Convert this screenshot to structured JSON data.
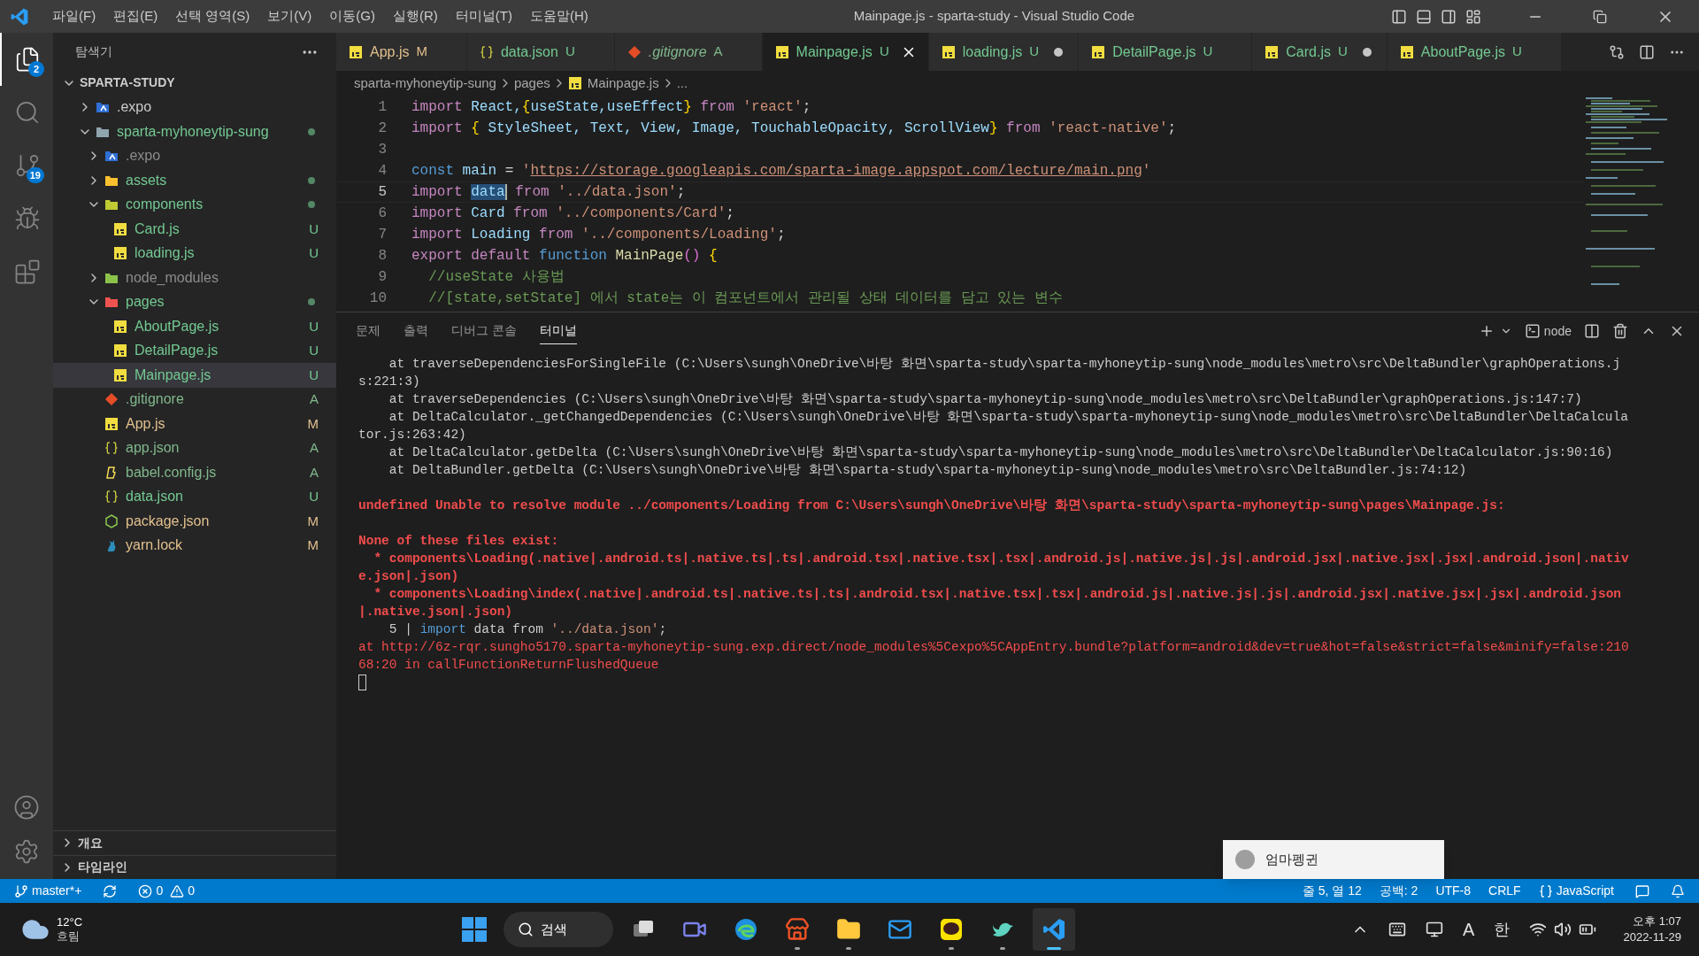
{
  "window": {
    "title": "Mainpage.js - sparta-study - Visual Studio Code"
  },
  "menu": [
    "파일(F)",
    "편집(E)",
    "선택 영역(S)",
    "보기(V)",
    "이동(G)",
    "실행(R)",
    "터미널(T)",
    "도움말(H)"
  ],
  "activity_bar": [
    {
      "kind": "explorer",
      "selected": true,
      "badge": "2"
    },
    {
      "kind": "search",
      "selected": false
    },
    {
      "kind": "source-control",
      "selected": false,
      "badge": "19"
    },
    {
      "kind": "debug",
      "selected": false
    },
    {
      "kind": "extensions",
      "selected": false
    }
  ],
  "sidebar": {
    "title": "탐색기",
    "root": {
      "label": "SPARTA-STUDY",
      "expanded": true
    },
    "tree": [
      {
        "name": ".expo",
        "kind": "folder-expo",
        "color": "#cccccc",
        "expanded": false,
        "dot": false,
        "selected": false
      },
      {
        "name": "sparta-myhoneytip-sung",
        "kind": "folder",
        "color": "#73c991",
        "expanded": true,
        "dot": true,
        "selected": false,
        "children": [
          {
            "name": ".expo",
            "kind": "folder-expo",
            "color": "#8c8c8c",
            "expanded": false,
            "dot": false,
            "selected": false
          },
          {
            "name": "assets",
            "kind": "folder-assets",
            "color": "#73c991",
            "expanded": false,
            "dot": true,
            "selected": false
          },
          {
            "name": "components",
            "kind": "folder-components",
            "color": "#73c991",
            "expanded": true,
            "dot": true,
            "selected": false,
            "children": [
              {
                "name": "Card.js",
                "kind": "js",
                "color": "#73c991",
                "badge": "U",
                "selected": false
              },
              {
                "name": "loading.js",
                "kind": "js",
                "color": "#73c991",
                "badge": "U",
                "selected": false
              }
            ]
          },
          {
            "name": "node_modules",
            "kind": "folder-node",
            "color": "#8c8c8c",
            "expanded": false,
            "dot": false,
            "selected": false
          },
          {
            "name": "pages",
            "kind": "folder-pages",
            "color": "#73c991",
            "expanded": true,
            "dot": true,
            "selected": false,
            "children": [
              {
                "name": "AboutPage.js",
                "kind": "js",
                "color": "#73c991",
                "badge": "U",
                "selected": false
              },
              {
                "name": "DetailPage.js",
                "kind": "js",
                "color": "#73c991",
                "badge": "U",
                "selected": false
              },
              {
                "name": "Mainpage.js",
                "kind": "js",
                "color": "#73c991",
                "badge": "U",
                "selected": true
              }
            ]
          },
          {
            "name": ".gitignore",
            "kind": "git",
            "color": "#81b88b",
            "badge": "A",
            "selected": false
          },
          {
            "name": "App.js",
            "kind": "js",
            "color": "#e2c08d",
            "badge": "M",
            "selected": false
          },
          {
            "name": "app.json",
            "kind": "json",
            "color": "#81b88b",
            "badge": "A",
            "selected": false
          },
          {
            "name": "babel.config.js",
            "kind": "babel",
            "color": "#81b88b",
            "badge": "A",
            "selected": false
          },
          {
            "name": "data.json",
            "kind": "json",
            "color": "#73c991",
            "badge": "U",
            "selected": false
          },
          {
            "name": "package.json",
            "kind": "node",
            "color": "#e2c08d",
            "badge": "M",
            "selected": false
          },
          {
            "name": "yarn.lock",
            "kind": "yarn",
            "color": "#e2c08d",
            "badge": "M",
            "selected": false
          }
        ]
      }
    ],
    "sections": [
      {
        "label": "개요",
        "expanded": false
      },
      {
        "label": "타임라인",
        "expanded": false
      }
    ]
  },
  "tabs": [
    {
      "label": "App.js",
      "kind": "js",
      "color": "#e2c08d",
      "badge": "M",
      "selected": false,
      "dirty": false,
      "preview": false
    },
    {
      "label": "data.json",
      "kind": "json",
      "color": "#73c991",
      "badge": "U",
      "selected": false,
      "dirty": false,
      "preview": false
    },
    {
      "label": ".gitignore",
      "kind": "git",
      "color": "#81b88b",
      "badge": "A",
      "selected": false,
      "dirty": false,
      "preview": true
    },
    {
      "label": "Mainpage.js",
      "kind": "js",
      "color": "#73c991",
      "badge": "U",
      "selected": true,
      "dirty": false,
      "preview": false
    },
    {
      "label": "loading.js",
      "kind": "js",
      "color": "#73c991",
      "badge": "U",
      "selected": false,
      "dirty": true,
      "preview": false
    },
    {
      "label": "DetailPage.js",
      "kind": "js",
      "color": "#73c991",
      "badge": "U",
      "selected": false,
      "dirty": false,
      "preview": false
    },
    {
      "label": "Card.js",
      "kind": "js",
      "color": "#73c991",
      "badge": "U",
      "selected": false,
      "dirty": true,
      "preview": false
    },
    {
      "label": "AboutPage.js",
      "kind": "js",
      "color": "#73c991",
      "badge": "U",
      "selected": false,
      "dirty": false,
      "preview": false
    }
  ],
  "breadcrumb": [
    "sparta-myhoneytip-sung",
    "pages",
    "Mainpage.js",
    "..."
  ],
  "code": [
    {
      "number": "1",
      "current": false,
      "tokens": [
        {
          "t": "import",
          "kind": "kw"
        },
        {
          "t": " React,",
          "kind": "var"
        },
        {
          "t": "{",
          "kind": "brace"
        },
        {
          "t": "useState,useEffect",
          "kind": "var"
        },
        {
          "t": "}",
          "kind": "brace"
        },
        {
          "t": " from",
          "kind": "kw"
        },
        {
          "t": " 'react'",
          "kind": "str"
        },
        {
          "t": ";",
          "kind": "punc"
        }
      ]
    },
    {
      "number": "2",
      "current": false,
      "tokens": [
        {
          "t": "import",
          "kind": "kw"
        },
        {
          "t": " {",
          "kind": "brace"
        },
        {
          "t": " StyleSheet, Text, View, Image, TouchableOpacity, ScrollView",
          "kind": "var"
        },
        {
          "t": "}",
          "kind": "brace"
        },
        {
          "t": " from",
          "kind": "kw"
        },
        {
          "t": " 'react-native'",
          "kind": "str"
        },
        {
          "t": ";",
          "kind": "punc"
        }
      ]
    },
    {
      "number": "3",
      "current": false
    },
    {
      "number": "4",
      "current": false,
      "tokens": [
        {
          "t": "const",
          "kind": "storage"
        },
        {
          "t": " main",
          "kind": "var"
        },
        {
          "t": " = ",
          "kind": "punc"
        },
        {
          "t": "'",
          "kind": "str"
        },
        {
          "t": "https://storage.googleapis.com/sparta-image.appspot.com/lecture/main.png",
          "kind": "link"
        },
        {
          "t": "'",
          "kind": "str"
        }
      ]
    },
    {
      "number": "5",
      "current": true,
      "tokens": [
        {
          "t": "import ",
          "kind": "kw"
        },
        {
          "t": "data",
          "kind": "var",
          "selected": true
        },
        {
          "t": " from",
          "kind": "kw"
        },
        {
          "t": " '../data.json'",
          "kind": "str"
        },
        {
          "t": ";",
          "kind": "punc"
        }
      ]
    },
    {
      "number": "6",
      "current": false,
      "tokens": [
        {
          "t": "import",
          "kind": "kw"
        },
        {
          "t": " Card",
          "kind": "var"
        },
        {
          "t": " from",
          "kind": "kw"
        },
        {
          "t": " '../components/Card'",
          "kind": "str"
        },
        {
          "t": ";",
          "kind": "punc"
        }
      ]
    },
    {
      "number": "7",
      "current": false,
      "tokens": [
        {
          "t": "import",
          "kind": "kw"
        },
        {
          "t": " Loading",
          "kind": "var"
        },
        {
          "t": " from",
          "kind": "kw"
        },
        {
          "t": " '../components/Loading'",
          "kind": "str"
        },
        {
          "t": ";",
          "kind": "punc"
        }
      ]
    },
    {
      "number": "8",
      "current": false,
      "tokens": [
        {
          "t": "export",
          "kind": "kw"
        },
        {
          "t": " default",
          "kind": "kw"
        },
        {
          "t": " function",
          "kind": "storage"
        },
        {
          "t": " MainPage",
          "kind": "fn"
        },
        {
          "t": "()",
          "kind": "paren"
        },
        {
          "t": " {",
          "kind": "brace"
        }
      ]
    },
    {
      "number": "9",
      "current": false,
      "tokens": [
        {
          "t": "  //useState 사용법",
          "kind": "comment"
        }
      ]
    },
    {
      "number": "10",
      "current": false,
      "tokens": [
        {
          "t": "  //[state,setState] 에서 state는 이 컴포넌트에서 관리될 상태 데이터를 담고 있는 변수",
          "kind": "comment"
        }
      ]
    }
  ],
  "panel": {
    "tabs": [
      {
        "label": "문제",
        "selected": false
      },
      {
        "label": "출력",
        "selected": false
      },
      {
        "label": "디버그 콘솔",
        "selected": false
      },
      {
        "label": "터미널",
        "selected": true
      }
    ],
    "terminal_name": "node",
    "lines": [
      {
        "kind": "trace",
        "text": "    at traverseDependenciesForSingleFile (C:\\Users\\sungh\\OneDrive\\바탕 화면\\sparta-study\\sparta-myhoneytip-sung\\node_modules\\metro\\src\\DeltaBundler\\graphOperations.js:221:3)"
      },
      {
        "kind": "trace",
        "text": "    at traverseDependencies (C:\\Users\\sungh\\OneDrive\\바탕 화면\\sparta-study\\sparta-myhoneytip-sung\\node_modules\\metro\\src\\DeltaBundler\\graphOperations.js:147:7)"
      },
      {
        "kind": "trace",
        "text": "    at DeltaCalculator._getChangedDependencies (C:\\Users\\sungh\\OneDrive\\바탕 화면\\sparta-study\\sparta-myhoneytip-sung\\node_modules\\metro\\src\\DeltaBundler\\DeltaCalculator.js:263:42)"
      },
      {
        "kind": "trace",
        "text": "    at DeltaCalculator.getDelta (C:\\Users\\sungh\\OneDrive\\바탕 화면\\sparta-study\\sparta-myhoneytip-sung\\node_modules\\metro\\src\\DeltaBundler\\DeltaCalculator.js:90:16)"
      },
      {
        "kind": "trace",
        "text": "    at DeltaBundler.getDelta (C:\\Users\\sungh\\OneDrive\\바탕 화면\\sparta-study\\sparta-myhoneytip-sung\\node_modules\\metro\\src\\DeltaBundler.js:74:12)"
      },
      {
        "kind": "blank"
      },
      {
        "kind": "error",
        "text": "undefined Unable to resolve module ../components/Loading from C:\\Users\\sungh\\OneDrive\\바탕 화면\\sparta-study\\sparta-myhoneytip-sung\\pages\\Mainpage.js:"
      },
      {
        "kind": "blank"
      },
      {
        "kind": "error",
        "text": "None of these files exist:"
      },
      {
        "kind": "error",
        "text": "  * components\\Loading(.native|.android.ts|.native.ts|.ts|.android.tsx|.native.tsx|.tsx|.android.js|.native.js|.js|.android.jsx|.native.jsx|.jsx|.android.json|.native.json|.json)"
      },
      {
        "kind": "error",
        "text": "  * components\\Loading\\index(.native|.android.ts|.native.ts|.ts|.android.tsx|.native.tsx|.tsx|.android.js|.native.js|.js|.android.jsx|.native.jsx|.jsx|.android.json|.native.json|.json)"
      },
      {
        "kind": "code",
        "parts": [
          {
            "t": "    5 | ",
            "kind": "gutter"
          },
          {
            "t": "import",
            "kind": "storage"
          },
          {
            "t": " data from ",
            "kind": "plain"
          },
          {
            "t": "'../data.json'",
            "kind": "str"
          },
          {
            "t": ";",
            "kind": "plain"
          }
        ]
      },
      {
        "kind": "location",
        "text": "at http://6z-rqr.sungho5170.sparta-myhoneytip-sung.exp.direct/node_modules%5Cexpo%5CAppEntry.bundle?platform=android&dev=true&hot=false&strict=false&minify=false:21068:20 in callFunctionReturnFlushedQueue"
      },
      {
        "kind": "cursor"
      }
    ]
  },
  "status_bar": {
    "branch": "master*+",
    "errors": "0",
    "warnings": "0",
    "right": [
      "줄 5, 열 12",
      "공백: 2",
      "UTF-8",
      "CRLF"
    ],
    "language": "JavaScript"
  },
  "notification": {
    "title": "엄마펭귄"
  },
  "taskbar": {
    "weather": {
      "temp": "12°C",
      "condition": "흐림"
    },
    "search": "검색",
    "apps": [
      {
        "kind": "taskview",
        "selected": false,
        "running": false
      },
      {
        "kind": "chat",
        "selected": false,
        "running": false
      },
      {
        "kind": "edge",
        "selected": false,
        "running": false
      },
      {
        "kind": "store",
        "selected": false,
        "running": true
      },
      {
        "kind": "explorer",
        "selected": false,
        "running": true
      },
      {
        "kind": "mail",
        "selected": false,
        "running": false
      },
      {
        "kind": "kakao",
        "selected": false,
        "running": true
      },
      {
        "kind": "bird",
        "selected": false,
        "running": true
      },
      {
        "kind": "vscode",
        "selected": true,
        "running": true
      }
    ],
    "ime_mode": "A",
    "ime_lang": "한",
    "time": "오후 1:07",
    "date": "2022-11-29"
  }
}
